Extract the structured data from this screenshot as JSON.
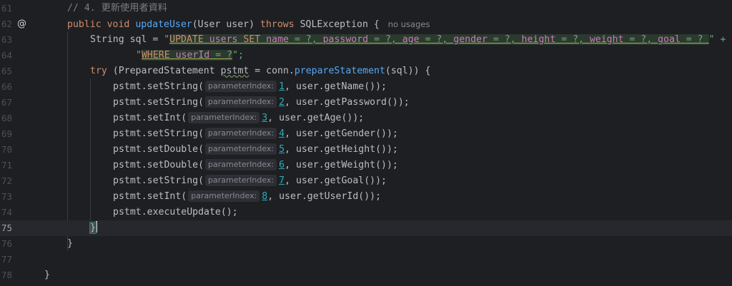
{
  "lines": [
    {
      "n": "61",
      "comment": "// 4. 更新使用者資料"
    },
    {
      "n": "62",
      "kw1": "public",
      "kw2": "void",
      "fn": "updateUser",
      "params": "(User user)",
      "kw3": "throws",
      "rest": "SQLException {",
      "usages": "no usages"
    },
    {
      "n": "63",
      "pre": "String sql = ",
      "q": "\"",
      "sql": [
        {
          "t": "kw",
          "v": "UPDATE"
        },
        {
          "t": "sp",
          "v": " "
        },
        {
          "t": "id",
          "v": "users"
        },
        {
          "t": "sp",
          "v": " "
        },
        {
          "t": "kw",
          "v": "SET"
        },
        {
          "t": "sp",
          "v": " "
        },
        {
          "t": "id",
          "v": "name"
        },
        {
          "t": "op",
          "v": " = ?, "
        },
        {
          "t": "id",
          "v": "password"
        },
        {
          "t": "op",
          "v": " = ?, "
        },
        {
          "t": "id",
          "v": "age"
        },
        {
          "t": "op",
          "v": " = ?, "
        },
        {
          "t": "id",
          "v": "gender"
        },
        {
          "t": "op",
          "v": " = ?, "
        },
        {
          "t": "id",
          "v": "height"
        },
        {
          "t": "op",
          "v": " = ?, "
        },
        {
          "t": "id",
          "v": "weight"
        },
        {
          "t": "op",
          "v": " = ?, "
        },
        {
          "t": "id",
          "v": "goal"
        },
        {
          "t": "op",
          "v": " = ? "
        }
      ],
      "end": "\" +"
    },
    {
      "n": "64",
      "q": "\"",
      "sql": [
        {
          "t": "kw",
          "v": "WHERE"
        },
        {
          "t": "sp",
          "v": " "
        },
        {
          "t": "id",
          "v": "userId"
        },
        {
          "t": "op",
          "v": " = ?"
        }
      ],
      "end": "\";"
    },
    {
      "n": "65",
      "kw": "try",
      "a": " (PreparedStatement ",
      "var": "pstmt",
      "b": " = conn.",
      "fn": "prepareStatement",
      "c": "(sql)) {"
    },
    {
      "n": "66",
      "obj": "pstmt.",
      "m": "setString(",
      "hint": "parameterIndex:",
      "idx": "1",
      "arg": ", user.getName());"
    },
    {
      "n": "67",
      "obj": "pstmt.",
      "m": "setString(",
      "hint": "parameterIndex:",
      "idx": "2",
      "arg": ", user.getPassword());"
    },
    {
      "n": "68",
      "obj": "pstmt.",
      "m": "setInt(",
      "hint": "parameterIndex:",
      "idx": "3",
      "arg": ", user.getAge());"
    },
    {
      "n": "69",
      "obj": "pstmt.",
      "m": "setString(",
      "hint": "parameterIndex:",
      "idx": "4",
      "arg": ", user.getGender());"
    },
    {
      "n": "70",
      "obj": "pstmt.",
      "m": "setDouble(",
      "hint": "parameterIndex:",
      "idx": "5",
      "arg": ", user.getHeight());"
    },
    {
      "n": "71",
      "obj": "pstmt.",
      "m": "setDouble(",
      "hint": "parameterIndex:",
      "idx": "6",
      "arg": ", user.getWeight());"
    },
    {
      "n": "72",
      "obj": "pstmt.",
      "m": "setString(",
      "hint": "parameterIndex:",
      "idx": "7",
      "arg": ", user.getGoal());"
    },
    {
      "n": "73",
      "obj": "pstmt.",
      "m": "setInt(",
      "hint": "parameterIndex:",
      "idx": "8",
      "arg": ", user.getUserId());"
    },
    {
      "n": "74",
      "plain": "pstmt.executeUpdate();"
    },
    {
      "n": "75",
      "brace": "}"
    },
    {
      "n": "76",
      "plain": "}"
    },
    {
      "n": "77",
      "plain": ""
    },
    {
      "n": "78",
      "plain": "}"
    }
  ],
  "gutter_icon": "@",
  "current_line": "75"
}
